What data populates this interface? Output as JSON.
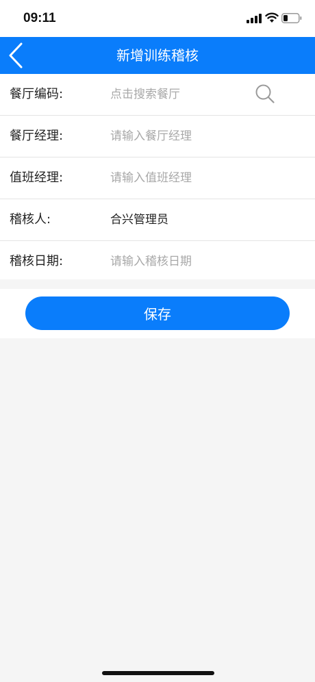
{
  "status_bar": {
    "time": "09:11"
  },
  "nav": {
    "title": "新增训练稽核",
    "back_icon": "chevron-left-icon"
  },
  "form": {
    "restaurant_code": {
      "label": "餐厅编码:",
      "placeholder": "点击搜索餐厅",
      "icon": "search-icon"
    },
    "restaurant_manager": {
      "label": "餐厅经理:",
      "placeholder": "请输入餐厅经理"
    },
    "shift_manager": {
      "label": "值班经理:",
      "placeholder": "请输入值班经理"
    },
    "auditor": {
      "label": "稽核人:",
      "value": "合兴管理员"
    },
    "audit_date": {
      "label": "稽核日期:",
      "placeholder": "请输入稽核日期"
    }
  },
  "actions": {
    "save_label": "保存"
  },
  "colors": {
    "primary": "#0a7dfb",
    "background": "#f5f5f5",
    "placeholder": "#a8a8a8"
  }
}
